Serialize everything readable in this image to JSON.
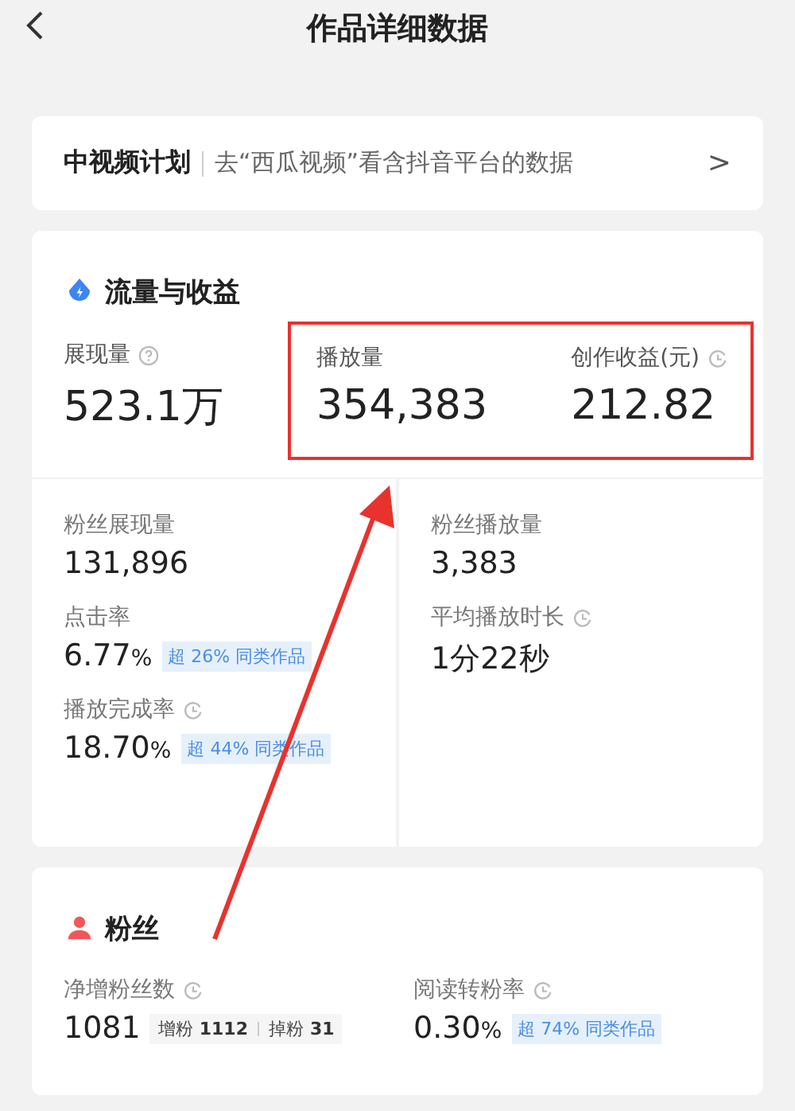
{
  "header": {
    "title": "作品详细数据"
  },
  "plan_banner": {
    "name": "中视频计划",
    "link": "去“西瓜视频”看含抖音平台的数据",
    "chevron": ">"
  },
  "traffic": {
    "title": "流量与收益",
    "top_metrics": [
      {
        "kind": "help",
        "label": "展现量",
        "value": "523.1万"
      }
    ],
    "highlight_box": {
      "metrics": [
        {
          "kind": "plain",
          "label": "播放量",
          "value": "354,383"
        },
        {
          "kind": "refresh",
          "label": "创作收益(元)",
          "value": "212.82"
        }
      ]
    },
    "metrics": [
      {
        "kind": "plain",
        "label": "粉丝展现量",
        "value": "131,896"
      },
      {
        "kind": "plain",
        "label": "粉丝播放量",
        "value": "3,383"
      },
      {
        "kind": "plain",
        "label": "点击率",
        "value": "6.77",
        "unit": "%",
        "badge": "超 26% 同类作品"
      },
      {
        "kind": "refresh",
        "label": "平均播放时长",
        "value": "1分22秒"
      },
      {
        "kind": "refresh",
        "label": "播放完成率",
        "value": "18.70",
        "unit": "%",
        "badge": "超 44% 同类作品"
      }
    ]
  },
  "fans": {
    "title": "粉丝",
    "metrics": [
      {
        "kind": "refresh",
        "label": "净增粉丝数",
        "value": "1081",
        "breakdown": [
          {
            "label": "增粉",
            "value": "1112"
          },
          {
            "label": "掉粉",
            "value": "31"
          }
        ]
      },
      {
        "kind": "refresh",
        "label": "阅读转粉率",
        "value": "0.30",
        "unit": "%",
        "badge": "超 74% 同类作品"
      }
    ]
  }
}
